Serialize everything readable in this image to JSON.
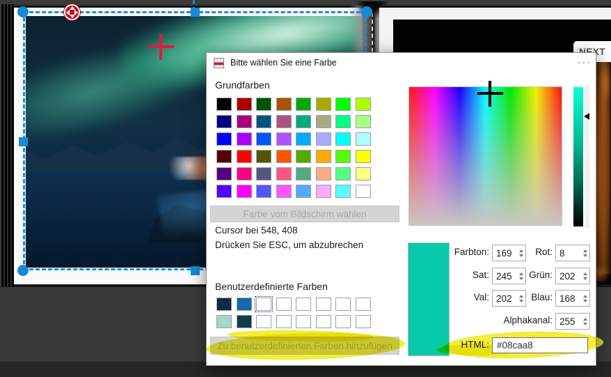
{
  "stage": {
    "next_label_first": "N",
    "next_label_rest": "EXT",
    "selection_accent": "#1b8ed8",
    "crosshair_color": "#e11b3c"
  },
  "dialog": {
    "title": "Bitte wählen Sie eine Farbe",
    "basic_section": {
      "label": "Grundfarben",
      "colors": [
        "#000000",
        "#aa0000",
        "#005500",
        "#aa5500",
        "#00aa00",
        "#aaaa00",
        "#00ff00",
        "#aaff00",
        "#000080",
        "#aa0080",
        "#005580",
        "#aa5580",
        "#00aa80",
        "#aaaa80",
        "#00ff80",
        "#aaff80",
        "#0000ff",
        "#aa00ff",
        "#0055ff",
        "#aa55ff",
        "#00aaff",
        "#aaaaff",
        "#00ffff",
        "#aaffff",
        "#550000",
        "#ff0000",
        "#555500",
        "#ff5500",
        "#55aa00",
        "#ffaa00",
        "#55ff00",
        "#ffff00",
        "#550080",
        "#ff0080",
        "#555580",
        "#ff5580",
        "#55aa80",
        "#ffaa80",
        "#55ff80",
        "#ffff80",
        "#5500ff",
        "#ff00ff",
        "#5555ff",
        "#ff55ff",
        "#55aaff",
        "#ffaaff",
        "#55ffff",
        "#ffffff"
      ]
    },
    "pick_screen_button": "Farbe vom Bildschirm wählen",
    "cursor_line1": "Cursor bei 548, 408",
    "cursor_line2": "Drücken Sie ESC, um abzubrechen",
    "custom_section": {
      "label": "Benutzerdefinierte Farben",
      "colors": [
        "#0d2b45",
        "#1668a8",
        "#ffffff",
        "#ffffff",
        "#ffffff",
        "#ffffff",
        "#ffffff",
        "#ffffff",
        "#a3d8cb",
        "#0e3d4b",
        "#ffffff",
        "#ffffff",
        "#ffffff",
        "#ffffff",
        "#ffffff",
        "#ffffff"
      ]
    },
    "add_custom_button": "Zu benutzerdefinierten Farben hinzufügen",
    "fields": {
      "hue": {
        "label": "Farbton:",
        "value": "169"
      },
      "sat": {
        "label": "Sat:",
        "value": "245"
      },
      "val": {
        "label": "Val:",
        "value": "202"
      },
      "red": {
        "label": "Rot:",
        "value": "8"
      },
      "green": {
        "label": "Grün:",
        "value": "202"
      },
      "blue": {
        "label": "Blau:",
        "value": "168"
      },
      "alpha": {
        "label": "Alphakanal:",
        "value": "255"
      },
      "html": {
        "label": "HTML:",
        "value": "#08caa8"
      }
    },
    "preview_color": "#08caa8",
    "highlight_color": "#f1ec25"
  }
}
